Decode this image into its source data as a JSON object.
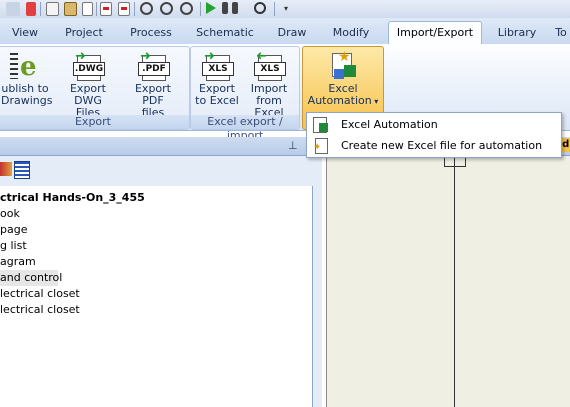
{
  "tabs": [
    {
      "label": "View"
    },
    {
      "label": "Project"
    },
    {
      "label": "Process"
    },
    {
      "label": "Schematic"
    },
    {
      "label": "Draw"
    },
    {
      "label": "Modify"
    },
    {
      "label": "Import/Export",
      "active": true
    },
    {
      "label": "Library"
    },
    {
      "label": "To"
    }
  ],
  "ribbon": {
    "export_group": {
      "caption": "Export",
      "publish": {
        "line1": "ublish to",
        "line2": "Drawings"
      },
      "dwg": {
        "line1": "Export DWG",
        "line2": "Files",
        "icon_text": ".DWG"
      },
      "pdf": {
        "line1": "Export PDF",
        "line2": "files",
        "icon_text": ".PDF"
      }
    },
    "excel_group": {
      "caption": "Excel export / import",
      "export": {
        "line1": "Export",
        "line2": "to Excel",
        "icon_text": "XLS"
      },
      "import": {
        "line1": "Import",
        "line2": "from Excel",
        "icon_text": "XLS"
      }
    },
    "automation": {
      "line1": "Excel",
      "line2": "Automation"
    }
  },
  "menu": {
    "items": [
      {
        "label": "Excel Automation",
        "icon": "excel-automation-icon"
      },
      {
        "label": "Create new Excel file for automation",
        "icon": "new-excel-file-icon"
      }
    ]
  },
  "panel": {
    "right_label": "nd"
  },
  "tree": {
    "items": [
      {
        "label": "ctrical Hands-On_3_455",
        "bold": true
      },
      {
        "label": "ook"
      },
      {
        "label": "page"
      },
      {
        "label": "g list"
      },
      {
        "label": "agram"
      },
      {
        "label": " and control",
        "selected": true
      },
      {
        "label": "lectrical closet"
      },
      {
        "label": "lectrical closet"
      }
    ]
  },
  "colors": {
    "accent": "#f7c24a",
    "tab_bg": "#c9d9f0",
    "selected_row": "#e6e6e6"
  }
}
